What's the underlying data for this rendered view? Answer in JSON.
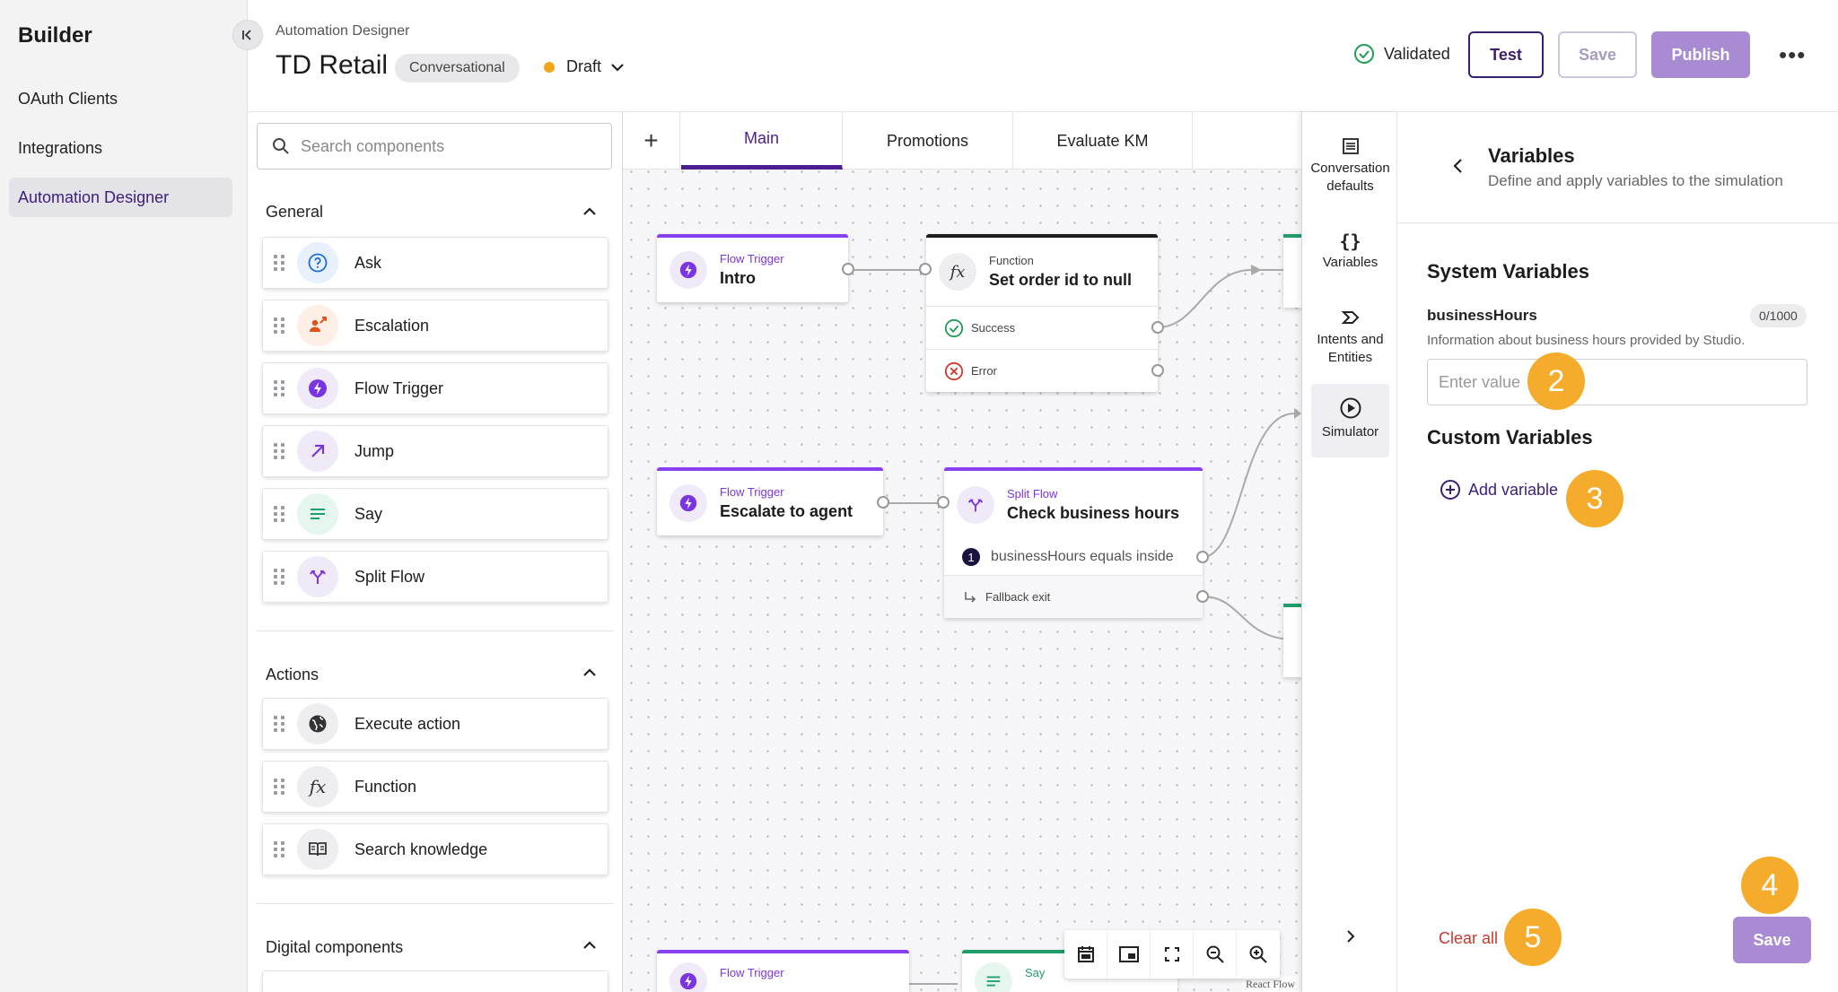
{
  "sidebar": {
    "title": "Builder",
    "items": [
      {
        "label": "OAuth Clients"
      },
      {
        "label": "Integrations"
      },
      {
        "label": "Automation Designer",
        "active": true
      }
    ]
  },
  "header": {
    "breadcrumb": "Automation Designer",
    "project": "TD Retail",
    "tag": "Conversational",
    "status": "Draft",
    "status_color": "#f2a71b",
    "validated": "Validated",
    "test_label": "Test",
    "save_label": "Save",
    "publish_label": "Publish",
    "more_label": "•••"
  },
  "components": {
    "search_placeholder": "Search components",
    "general_title": "General",
    "general": [
      {
        "label": "Ask",
        "icon": "question-icon"
      },
      {
        "label": "Escalation",
        "icon": "escalation-icon"
      },
      {
        "label": "Flow Trigger",
        "icon": "bolt-icon"
      },
      {
        "label": "Jump",
        "icon": "arrow-up-right-icon"
      },
      {
        "label": "Say",
        "icon": "text-lines-icon"
      },
      {
        "label": "Split Flow",
        "icon": "split-icon"
      }
    ],
    "actions_title": "Actions",
    "actions": [
      {
        "label": "Execute action",
        "icon": "globe-icon"
      },
      {
        "label": "Function",
        "icon": "fx-icon"
      },
      {
        "label": "Search knowledge",
        "icon": "book-icon"
      }
    ],
    "digital_title": "Digital components"
  },
  "tabs": [
    {
      "label": "Main",
      "active": true
    },
    {
      "label": "Promotions"
    },
    {
      "label": "Evaluate KM"
    }
  ],
  "canvas": {
    "node_intro": {
      "type": "Flow Trigger",
      "name": "Intro"
    },
    "node_func": {
      "type": "Function",
      "name": "Set order id to null",
      "success": "Success",
      "error": "Error"
    },
    "node_escalate": {
      "type": "Flow Trigger",
      "name": "Escalate to agent"
    },
    "node_split": {
      "type": "Split Flow",
      "name": "Check business hours",
      "condition_num": "1",
      "condition": "businessHours equals inside",
      "fallback": "Fallback exit"
    },
    "node_bottom1": {
      "type": "Flow Trigger"
    },
    "node_bottom2": {
      "type": "Say"
    },
    "attribution": "React Flow"
  },
  "right_nav": [
    {
      "label": "Conversation defaults",
      "icon": "list-icon"
    },
    {
      "label": "Variables",
      "icon": "braces-icon"
    },
    {
      "label": "Intents and Entities",
      "icon": "intent-icon"
    },
    {
      "label": "Simulator",
      "icon": "play-icon",
      "active": true
    }
  ],
  "variables": {
    "title": "Variables",
    "subtitle": "Define and apply variables to the simulation",
    "system_title": "System Variables",
    "var_name": "businessHours",
    "var_count": "0/1000",
    "var_desc": "Information about business hours provided by Studio.",
    "value_placeholder": "Enter value",
    "custom_title": "Custom Variables",
    "add_label": "Add variable",
    "clear_label": "Clear all",
    "save_label": "Save"
  },
  "badges": [
    "2",
    "3",
    "4",
    "5"
  ]
}
